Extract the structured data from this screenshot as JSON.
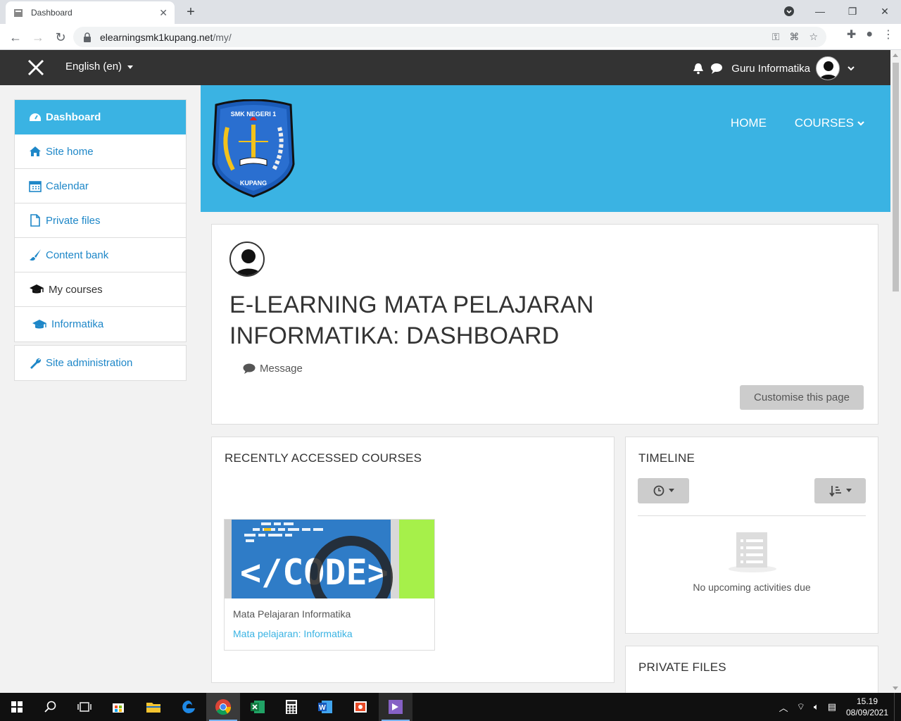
{
  "browser": {
    "tab_title": "Dashboard",
    "url_host": "elearningsmk1kupang.net",
    "url_path": "/my/"
  },
  "navbar": {
    "language": "English (en)",
    "user_name": "Guru Informatika"
  },
  "sidebar": {
    "items": [
      {
        "label": "Dashboard",
        "icon": "dashboard-icon"
      },
      {
        "label": "Site home",
        "icon": "home-icon"
      },
      {
        "label": "Calendar",
        "icon": "calendar-icon"
      },
      {
        "label": "Private files",
        "icon": "file-icon"
      },
      {
        "label": "Content bank",
        "icon": "brush-icon"
      },
      {
        "label": "My courses",
        "icon": "graduation-cap-icon"
      },
      {
        "label": "Informatika",
        "icon": "graduation-cap-icon"
      }
    ],
    "admin": {
      "label": "Site administration",
      "icon": "wrench-icon"
    }
  },
  "banner": {
    "logo_text_top": "SMK NEGERI 1",
    "logo_text_bottom": "KUPANG",
    "nav": {
      "home": "HOME",
      "courses": "COURSES"
    }
  },
  "page": {
    "title": "E-LEARNING MATA PELAJARAN INFORMATIKA: DASHBOARD",
    "message_label": "Message",
    "customise_label": "Customise this page"
  },
  "blocks": {
    "recent": {
      "title": "RECENTLY ACCESSED COURSES",
      "course": {
        "category": "Mata Pelajaran Informatika",
        "name": "Mata pelajaran: Informatika",
        "image_text": "</CODE>"
      }
    },
    "timeline": {
      "title": "TIMELINE",
      "empty": "No upcoming activities due"
    },
    "private_files": {
      "title": "PRIVATE FILES"
    }
  },
  "taskbar": {
    "time": "15.19",
    "date": "08/09/2021"
  }
}
